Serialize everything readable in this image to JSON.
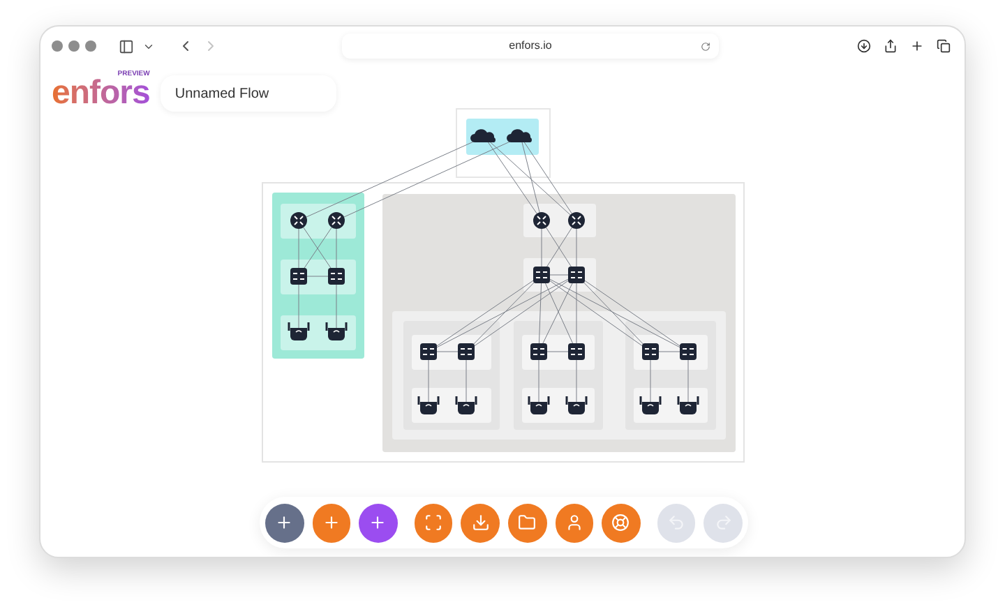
{
  "browser": {
    "url": "enfors.io",
    "forward_disabled": true
  },
  "app": {
    "logo": "enfors",
    "logo_badge": "PREVIEW",
    "flow_name": "Unnamed Flow"
  },
  "toolbar": [
    {
      "kind": "add",
      "color": "#66708a",
      "disabled": false
    },
    {
      "kind": "add",
      "color": "#f07a22",
      "disabled": false
    },
    {
      "kind": "add",
      "color": "#9b4df0",
      "disabled": false
    },
    {
      "kind": "fit",
      "color": "#f07a22",
      "disabled": false
    },
    {
      "kind": "download",
      "color": "#f07a22",
      "disabled": false
    },
    {
      "kind": "folder",
      "color": "#f07a22",
      "disabled": false
    },
    {
      "kind": "user",
      "color": "#f07a22",
      "disabled": false
    },
    {
      "kind": "help",
      "color": "#f07a22",
      "disabled": false
    },
    {
      "kind": "undo",
      "disabled": true
    },
    {
      "kind": "redo",
      "disabled": true
    }
  ]
}
